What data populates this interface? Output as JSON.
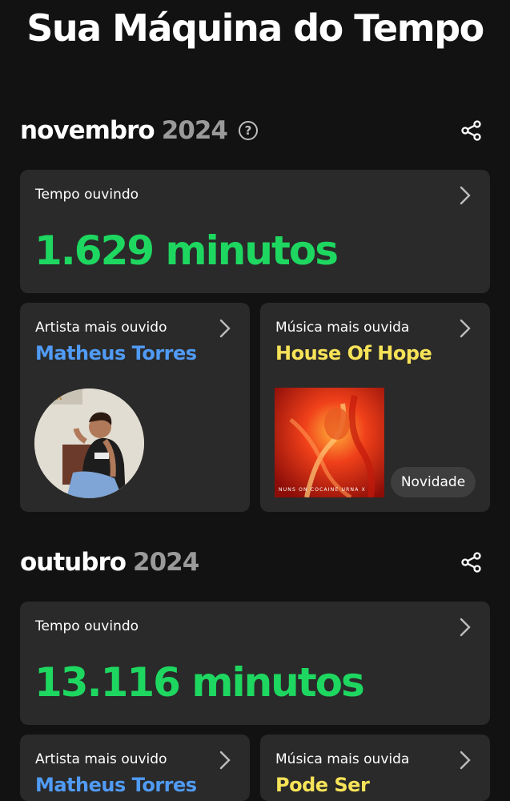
{
  "page": {
    "title": "Sua Máquina do Tempo"
  },
  "colors": {
    "green": "#1ed760",
    "artist_blue": "#509bf5",
    "track_yellow": "#f7e358",
    "card_bg": "#2a2a2a"
  },
  "sections": [
    {
      "month": "novembro",
      "year": "2024",
      "has_help": true,
      "share_icon": "share-icon",
      "listening": {
        "label": "Tempo ouvindo",
        "value": "1.629 minutos"
      },
      "top_artist": {
        "label": "Artista mais ouvido",
        "name": "Matheus Torres",
        "image": "artist-photo"
      },
      "top_track": {
        "label": "Música mais ouvida",
        "name": "House Of Hope",
        "badge": "Novidade",
        "cover_caption": "NUNS ON COCAINE URNA X"
      }
    },
    {
      "month": "outubro",
      "year": "2024",
      "has_help": false,
      "share_icon": "share-icon",
      "listening": {
        "label": "Tempo ouvindo",
        "value": "13.116 minutos"
      },
      "top_artist": {
        "label": "Artista mais ouvido",
        "name": "Matheus Torres"
      },
      "top_track": {
        "label": "Música mais ouvida",
        "name": "Pode Ser"
      }
    }
  ]
}
